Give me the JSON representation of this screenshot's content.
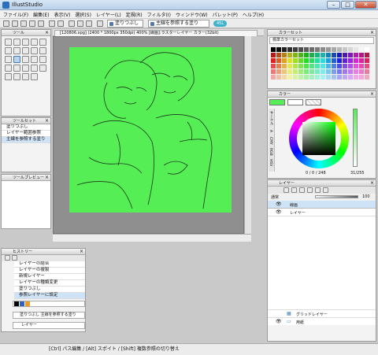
{
  "app": {
    "title": "IllustStudio"
  },
  "menu": [
    "ファイル(F)",
    "編集(E)",
    "表示(V)",
    "選択(S)",
    "レイヤー(L)",
    "定規(R)",
    "フィルタ(I)",
    "ウィンドウ(W)",
    "パレット(P)",
    "ヘルプ(H)"
  ],
  "cmdbar": {
    "combo1": "塗りつぶし",
    "combo2": "主線を参照する塗り",
    "pill": "45L"
  },
  "tool_panel": {
    "title": "ツール"
  },
  "subtool_panel": {
    "title": "ツールセット",
    "items": [
      "塗りつぶし",
      "レイヤー範囲参照",
      "主線を参照する塗り"
    ]
  },
  "preview_panel": {
    "title": "ツールプレビュー"
  },
  "history_panel": {
    "title": "ヒストリー",
    "items": [
      "レイヤーの結合",
      "レイヤーの複製",
      "新規レイヤー",
      "レイヤーの種類変更",
      "塗りつぶし",
      "参照レイヤーに設定"
    ],
    "option_text": "塗りつぶし 主線を参照する塗り",
    "layer_value": "レイヤー"
  },
  "document": {
    "tab_title": "[120806.xpg] (2400 * 1800px 350dpi) 400% [線画]:ラスターレイヤー カラー(32bit)"
  },
  "color_set": {
    "title": "カラーセット",
    "dropdown": "標準カラーセット"
  },
  "color_circle": {
    "title": "カラー",
    "side_tabs": [
      "サークル",
      "A",
      "CMY",
      "RGB",
      "HSV"
    ],
    "hsv_text": "0 / 0 / 248",
    "alpha_text": "31/255"
  },
  "layer_panel": {
    "title": "レイヤー",
    "blend_mode": "通常",
    "opacity": "100",
    "layers": [
      "線画",
      "レイヤー",
      "グリッドレイヤー",
      "用紙"
    ]
  },
  "status": {
    "hint": "[Ctrl] パス編集 / [Alt] スポイト / [Shift] 複数参照の切り替え"
  },
  "colors": {
    "canvas": "#55ee55",
    "selected": "#cfe3f7",
    "accent": "#3fb3c9"
  }
}
